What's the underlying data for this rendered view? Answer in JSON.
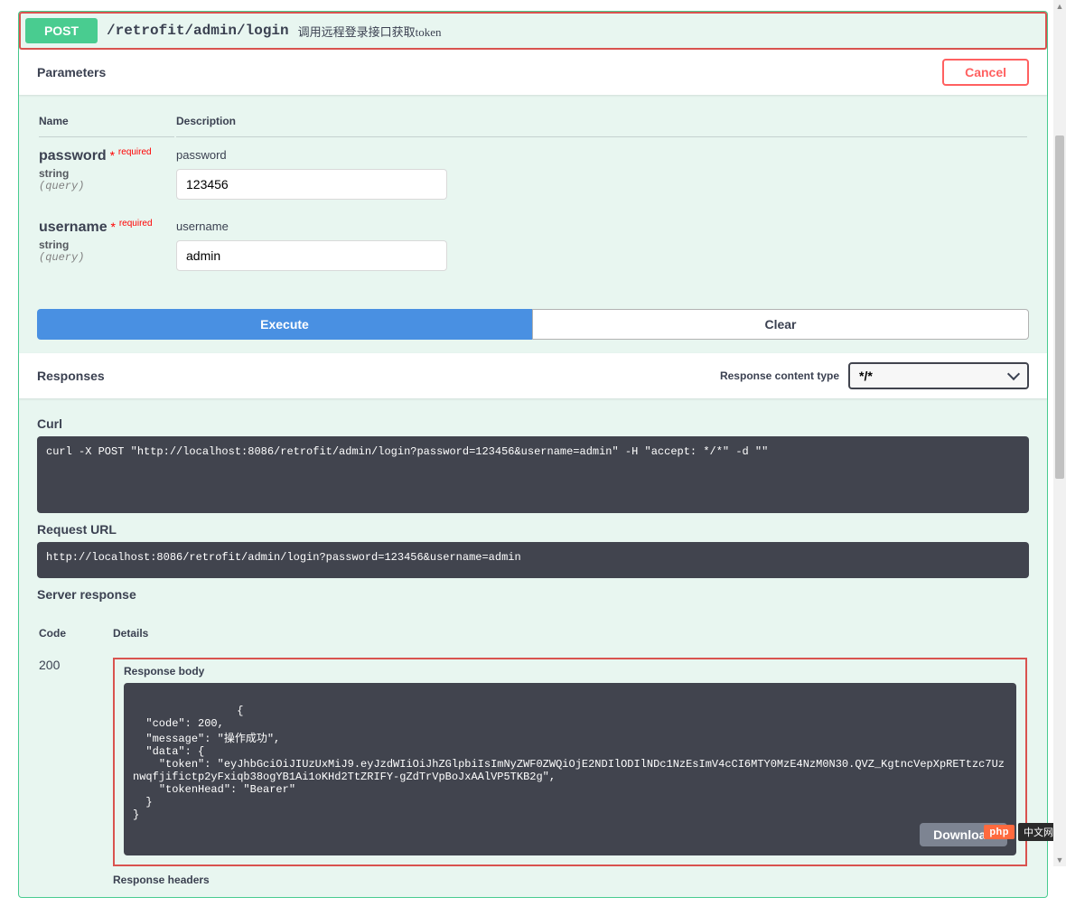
{
  "operation": {
    "method": "POST",
    "path": "/retrofit/admin/login",
    "summary": "调用远程登录接口获取token"
  },
  "parameters_section": {
    "title": "Parameters",
    "cancel_label": "Cancel",
    "name_header": "Name",
    "description_header": "Description"
  },
  "params": [
    {
      "name": "password",
      "required_star": "*",
      "required_label": "required",
      "type": "string",
      "in": "(query)",
      "description": "password",
      "value": "123456"
    },
    {
      "name": "username",
      "required_star": "*",
      "required_label": "required",
      "type": "string",
      "in": "(query)",
      "description": "username",
      "value": "admin"
    }
  ],
  "buttons": {
    "execute": "Execute",
    "clear": "Clear",
    "download": "Download"
  },
  "responses_section": {
    "title": "Responses",
    "content_type_label": "Response content type",
    "content_type_value": "*/*"
  },
  "curl": {
    "label": "Curl",
    "value": "curl -X POST \"http://localhost:8086/retrofit/admin/login?password=123456&username=admin\" -H \"accept: */*\" -d \"\""
  },
  "request_url": {
    "label": "Request URL",
    "value": "http://localhost:8086/retrofit/admin/login?password=123456&username=admin"
  },
  "server_response": {
    "label": "Server response",
    "code_header": "Code",
    "details_header": "Details",
    "code": "200",
    "body_label": "Response body",
    "body_text": "{\n  \"code\": 200,\n  \"message\": \"操作成功\",\n  \"data\": {\n    \"token\": \"eyJhbGciOiJIUzUxMiJ9.eyJzdWIiOiJhZGlpbiIsImNyZWF0ZWQiOjE2NDIlODIlNDc1NzEsImV4cCI6MTY0MzE4NzM0N30.QVZ_KgtncVepXpRETtzc7Uznwqfjifictp2yFxiqb38ogYB1Ai1oKHd2TtZRIFY-gZdTrVpBoJxAAlVP5TKB2g\",\n    \"tokenHead\": \"Bearer\"\n  }\n}",
    "headers_label": "Response headers"
  },
  "watermark": {
    "php": "php",
    "cn": "中文网"
  }
}
